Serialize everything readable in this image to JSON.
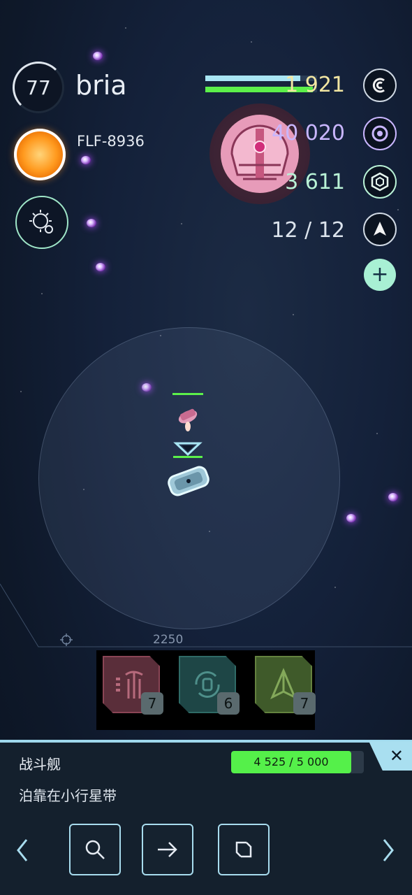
{
  "player": {
    "level": "77",
    "name": "bria",
    "system_code": "FLF-8936"
  },
  "resources": [
    {
      "value": "1 921",
      "color": "#f2e6a2",
      "icon": "credits-icon"
    },
    {
      "value": "40 020",
      "color": "#c9b6ff",
      "icon": "orb-icon"
    },
    {
      "value": "3 611",
      "color": "#b9f2d6",
      "icon": "hexagon-icon"
    },
    {
      "value": "12 / 12",
      "color": "#dbe3ec",
      "icon": "fleet-ship-icon"
    }
  ],
  "bars": {
    "shield": 0.85,
    "hull": 0.96,
    "shield_color": "#a9e6f4",
    "hull_color": "#5cf04a"
  },
  "map": {
    "scale_label": "2250"
  },
  "abilities": [
    {
      "icon": "palm-tree-icon",
      "count": "7",
      "color": "#5a2e3a",
      "border": "#8a4555"
    },
    {
      "icon": "recycle-shield-icon",
      "count": "6",
      "color": "#1e4646",
      "border": "#2f6a66"
    },
    {
      "icon": "arrowhead-icon",
      "count": "7",
      "color": "#3f5a2a",
      "border": "#64823f"
    }
  ],
  "selected_ship": {
    "type": "战斗舰",
    "status": "泊靠在小行星带",
    "hp_text": "4 525 / 5 000",
    "hp_fraction": 0.905,
    "close_label": "✕"
  },
  "actions": [
    "search-icon",
    "arrow-right-icon",
    "rotate-square-icon"
  ]
}
